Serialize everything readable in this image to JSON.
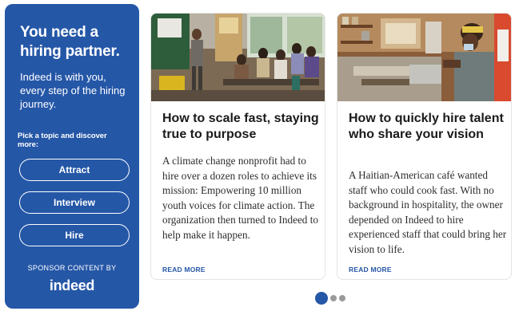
{
  "sidebar": {
    "title": "You need a hiring partner.",
    "subtitle": "Indeed is with you, every step of the hiring journey.",
    "prompt": "Pick a topic and discover more:",
    "topics": [
      "Attract",
      "Interview",
      "Hire"
    ],
    "sponsor_label": "SPONSOR CONTENT BY",
    "logo_text": "indeed",
    "background_color": "#2557a7"
  },
  "cards": [
    {
      "title": "How to scale fast, staying true to purpose",
      "body": "A climate change nonprofit had to hire over a dozen roles to achieve its mission: Empowering 10 million youth voices for climate action. The organization then turned to Indeed to help make it happen.",
      "link": "READ MORE"
    },
    {
      "title": "How to quickly hire talent who share your vision",
      "body": "A Haitian-American café wanted staff who could cook fast. With no background in hospitality, the owner depended on Indeed to hire experienced staff that could bring her vision to life.",
      "link": "READ MORE"
    }
  ],
  "pager": {
    "count": 3,
    "active_index": 0
  },
  "accent_color": "#2557a7"
}
